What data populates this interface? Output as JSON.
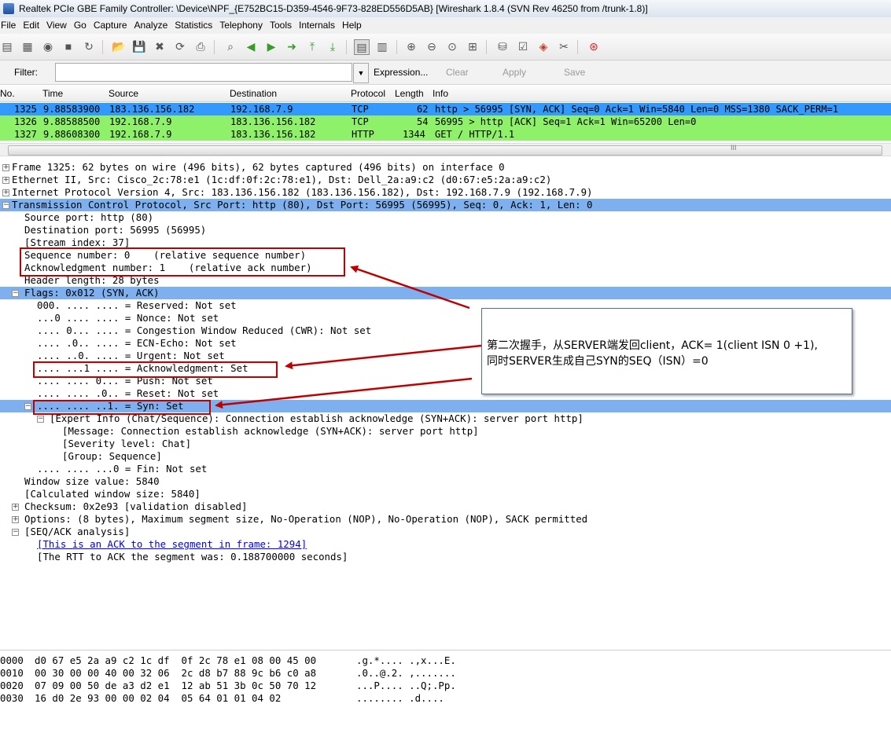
{
  "window": {
    "title": "Realtek PCIe GBE Family Controller: \\Device\\NPF_{E752BC15-D359-4546-9F73-828ED556D5AB}  [Wireshark 1.8.4  (SVN Rev 46250 from /trunk-1.8)]"
  },
  "menu": [
    "File",
    "Edit",
    "View",
    "Go",
    "Capture",
    "Analyze",
    "Statistics",
    "Telephony",
    "Tools",
    "Internals",
    "Help"
  ],
  "filter": {
    "label": "Filter:",
    "value": "",
    "expression": "Expression...",
    "clear": "Clear",
    "apply": "Apply",
    "save": "Save"
  },
  "packet_list": {
    "columns": [
      "No.",
      "Time",
      "Source",
      "Destination",
      "Protocol",
      "Length",
      "Info"
    ],
    "rows": [
      {
        "no": "1325",
        "time": "9.88583900",
        "src": "183.136.156.182",
        "dst": "192.168.7.9",
        "proto": "TCP",
        "len": "62",
        "info": "http > 56995 [SYN, ACK] Seq=0 Ack=1 Win=5840 Len=0 MSS=1380 SACK_PERM=1"
      },
      {
        "no": "1326",
        "time": "9.88588500",
        "src": "192.168.7.9",
        "dst": "183.136.156.182",
        "proto": "TCP",
        "len": "54",
        "info": "56995 > http [ACK] Seq=1 Ack=1 Win=65200 Len=0"
      },
      {
        "no": "1327",
        "time": "9.88608300",
        "src": "192.168.7.9",
        "dst": "183.136.156.182",
        "proto": "HTTP",
        "len": "1344",
        "info": "GET / HTTP/1.1"
      }
    ],
    "scroll_grip": "III"
  },
  "details": [
    "Frame 1325: 62 bytes on wire (496 bits), 62 bytes captured (496 bits) on interface 0",
    "Ethernet II, Src: Cisco_2c:78:e1 (1c:df:0f:2c:78:e1), Dst: Dell_2a:a9:c2 (d0:67:e5:2a:a9:c2)",
    "Internet Protocol Version 4, Src: 183.136.156.182 (183.136.156.182), Dst: 192.168.7.9 (192.168.7.9)",
    "Transmission Control Protocol, Src Port: http (80), Dst Port: 56995 (56995), Seq: 0, Ack: 1, Len: 0",
    "Source port: http (80)",
    "Destination port: 56995 (56995)",
    "[Stream index: 37]",
    "Sequence number: 0    (relative sequence number)",
    "Acknowledgment number: 1    (relative ack number)",
    "Header length: 28 bytes",
    "Flags: 0x012 (SYN, ACK)",
    "000. .... .... = Reserved: Not set",
    "...0 .... .... = Nonce: Not set",
    ".... 0... .... = Congestion Window Reduced (CWR): Not set",
    ".... .0.. .... = ECN-Echo: Not set",
    ".... ..0. .... = Urgent: Not set",
    ".... ...1 .... = Acknowledgment: Set",
    ".... .... 0... = Push: Not set",
    ".... .... .0.. = Reset: Not set",
    ".... .... ..1. = Syn: Set",
    "[Expert Info (Chat/Sequence): Connection establish acknowledge (SYN+ACK): server port http]",
    "[Message: Connection establish acknowledge (SYN+ACK): server port http]",
    "[Severity level: Chat]",
    "[Group: Sequence]",
    ".... .... ...0 = Fin: Not set",
    "Window size value: 5840",
    "[Calculated window size: 5840]",
    "Checksum: 0x2e93 [validation disabled]",
    "Options: (8 bytes), Maximum segment size, No-Operation (NOP), No-Operation (NOP), SACK permitted",
    "[SEQ/ACK analysis]",
    "[This is an ACK to the segment in frame: 1294]",
    "[The RTT to ACK the segment was: 0.188700000 seconds]"
  ],
  "hex": [
    {
      "off": "0000",
      "bytes": "d0 67 e5 2a a9 c2 1c df  0f 2c 78 e1 08 00 45 00",
      "ascii": ".g.*.... .,x...E."
    },
    {
      "off": "0010",
      "bytes": "00 30 00 00 40 00 32 06  2c d8 b7 88 9c b6 c0 a8",
      "ascii": ".0..@.2. ,......."
    },
    {
      "off": "0020",
      "bytes": "07 09 00 50 de a3 d2 e1  12 ab 51 3b 0c 50 70 12",
      "ascii": "...P.... ..Q;.Pp."
    },
    {
      "off": "0030",
      "bytes": "16 d0 2e 93 00 00 02 04  05 64 01 01 04 02",
      "ascii": "........ .d...."
    }
  ],
  "annotation": {
    "line1": "第二次握手，从SERVER端发回client，ACK= 1(client ISN 0 +1),",
    "line2": "同时SERVER生成自己SYN的SEQ（ISN）=0"
  },
  "colors": {
    "selected_row": "#3399ff",
    "tcp_row": "#8ff06a",
    "detail_highlight": "#7eb0ef",
    "annotation_red": "#c00000"
  }
}
